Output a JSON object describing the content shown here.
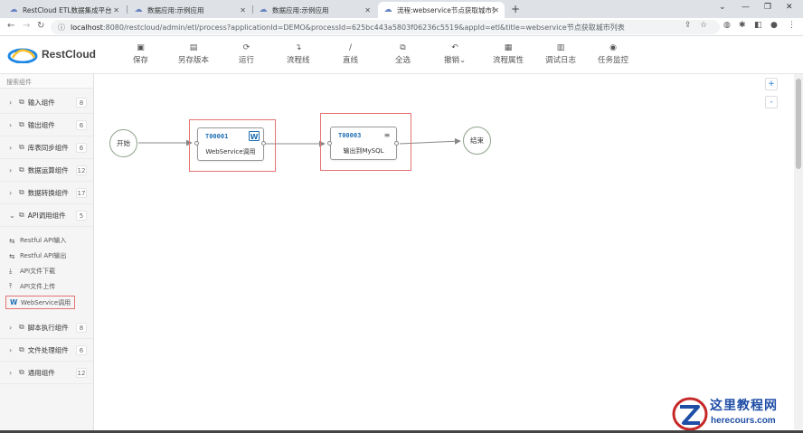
{
  "browser": {
    "tabs": [
      {
        "title": "RestCloud ETL数据集成平台"
      },
      {
        "title": "数据应用:示例应用"
      },
      {
        "title": "数据应用:示例应用"
      },
      {
        "title": "流程:webservice节点获取城市列"
      }
    ],
    "new_tab_icon": "+",
    "url_host": "localhost",
    "url_rest": ":8080/restcloud/admin/etl/process?applicationId=DEMO&processId=625bc443a5803f06236c5519&appId=etl&title=webservice节点获取城市列表"
  },
  "app": {
    "logo_text": "RestCloud",
    "toolbar": [
      {
        "label": "保存",
        "icon": "save-icon"
      },
      {
        "label": "另存版本",
        "icon": "save-as-icon"
      },
      {
        "label": "运行",
        "icon": "run-icon"
      },
      {
        "label": "流程线",
        "icon": "flow-line-icon"
      },
      {
        "label": "直线",
        "icon": "straight-line-icon"
      },
      {
        "label": "全选",
        "icon": "select-all-icon"
      },
      {
        "label": "撤销",
        "icon": "undo-icon"
      },
      {
        "label": "流程属性",
        "icon": "process-properties-icon"
      },
      {
        "label": "调试日志",
        "icon": "debug-log-icon"
      },
      {
        "label": "任务监控",
        "icon": "task-monitor-icon"
      }
    ]
  },
  "sidebar": {
    "search_placeholder": "搜索组件",
    "groups": [
      {
        "label": "输入组件",
        "count": "8"
      },
      {
        "label": "输出组件",
        "count": "6"
      },
      {
        "label": "库表同步组件",
        "count": "6"
      },
      {
        "label": "数据运算组件",
        "count": "12"
      },
      {
        "label": "数据转换组件",
        "count": "17"
      },
      {
        "label": "API调用组件",
        "count": "5"
      },
      {
        "label": "脚本执行组件",
        "count": "8"
      },
      {
        "label": "文件处理组件",
        "count": "6"
      },
      {
        "label": "通用组件",
        "count": "12"
      }
    ],
    "api_components": [
      {
        "label": "Restful API输入"
      },
      {
        "label": "Restful API输出"
      },
      {
        "label": "API文件下载"
      },
      {
        "label": "API文件上传"
      },
      {
        "label": "WebService调用"
      }
    ]
  },
  "canvas": {
    "zoom_in": "+",
    "zoom_out": "-",
    "start_label": "开始",
    "end_label": "结束",
    "nodes": [
      {
        "id": "T00001",
        "label": "WebService调用",
        "icon": "W"
      },
      {
        "id": "T00003",
        "label": "输出到MySQL",
        "icon": "≡"
      }
    ]
  },
  "watermark": {
    "title": "这里教程网",
    "subtitle": "herecours.com"
  },
  "colors": {
    "accent": "#1f6fb5",
    "highlight": "#e57373",
    "circle_border": "#8fa38a",
    "watermark": "#1f4ea6"
  }
}
